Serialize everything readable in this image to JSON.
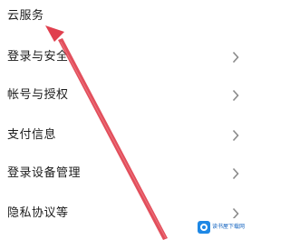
{
  "settings_menu": {
    "items": [
      {
        "label": "云服务"
      },
      {
        "label": "登录与安全"
      },
      {
        "label": "帐号与授权"
      },
      {
        "label": "支付信息"
      },
      {
        "label": "登录设备管理"
      },
      {
        "label": "隐私协议等"
      }
    ]
  },
  "colors": {
    "annotation_arrow": "#e0404e",
    "chevron": "#8a8a8a",
    "text": "#1c1c1c"
  },
  "icons": {
    "row_chevron": "chevron-right-icon",
    "watermark_logo": "site-logo-icon"
  },
  "watermark": {
    "text": "读书屋下载网"
  }
}
